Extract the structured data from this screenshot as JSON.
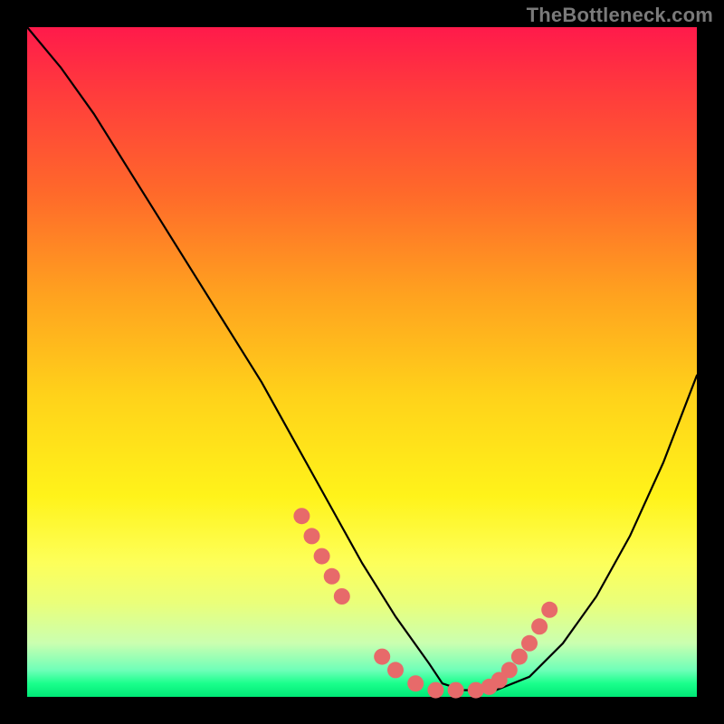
{
  "watermark": "TheBottleneck.com",
  "chart_data": {
    "type": "line",
    "title": "",
    "xlabel": "",
    "ylabel": "",
    "xlim": [
      0,
      100
    ],
    "ylim": [
      0,
      100
    ],
    "grid": false,
    "series": [
      {
        "name": "bottleneck-curve",
        "x": [
          0,
          5,
          10,
          15,
          20,
          25,
          30,
          35,
          40,
          45,
          50,
          55,
          60,
          62,
          65,
          70,
          75,
          80,
          85,
          90,
          95,
          100
        ],
        "values": [
          100,
          94,
          87,
          79,
          71,
          63,
          55,
          47,
          38,
          29,
          20,
          12,
          5,
          2,
          1,
          1,
          3,
          8,
          15,
          24,
          35,
          48
        ]
      }
    ],
    "markers": {
      "name": "highlight-dots",
      "color": "#e76a6a",
      "x": [
        41,
        42.5,
        44,
        45.5,
        47,
        53,
        55,
        58,
        61,
        64,
        67,
        69,
        70.5,
        72,
        73.5,
        75,
        76.5,
        78
      ],
      "values": [
        27,
        24,
        21,
        18,
        15,
        6,
        4,
        2,
        1,
        1,
        1,
        1.5,
        2.5,
        4,
        6,
        8,
        10.5,
        13
      ]
    },
    "background_gradient": {
      "top": "#ff1a4b",
      "mid": "#fff31a",
      "bottom": "#00e876"
    }
  }
}
